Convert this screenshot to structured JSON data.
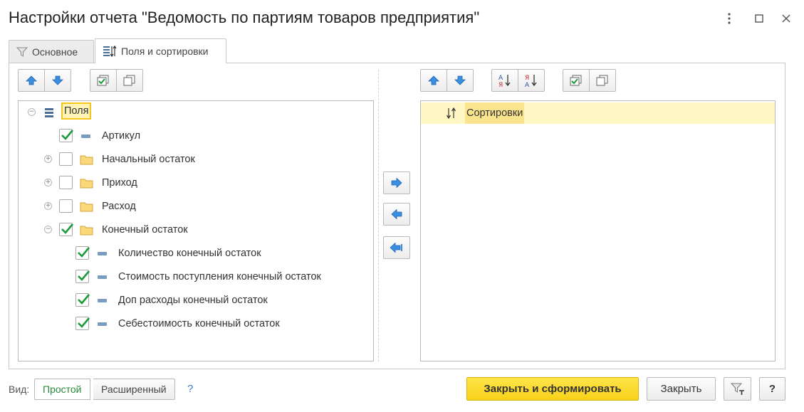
{
  "window": {
    "title": "Настройки отчета \"Ведомость по партиям товаров предприятия\""
  },
  "tabs": [
    {
      "label": "Основное",
      "icon": "filter-icon",
      "active": false
    },
    {
      "label": "Поля и сортировки",
      "icon": "fields-sort-icon",
      "active": true
    }
  ],
  "fields_tree": {
    "root": "Поля",
    "items": [
      {
        "label": "Артикул",
        "checked": true,
        "kind": "field"
      },
      {
        "label": "Начальный остаток",
        "checked": false,
        "kind": "folder",
        "expanded": false
      },
      {
        "label": "Приход",
        "checked": false,
        "kind": "folder",
        "expanded": false
      },
      {
        "label": "Расход",
        "checked": false,
        "kind": "folder",
        "expanded": false
      },
      {
        "label": "Конечный остаток",
        "checked": true,
        "kind": "folder",
        "expanded": true
      },
      {
        "label": "Количество конечный остаток",
        "checked": true,
        "kind": "field"
      },
      {
        "label": "Стоимость поступления конечный остаток",
        "checked": true,
        "kind": "field"
      },
      {
        "label": "Доп расходы конечный остаток",
        "checked": true,
        "kind": "field"
      },
      {
        "label": "Себестоимость конечный остаток",
        "checked": true,
        "kind": "field"
      }
    ]
  },
  "sort_tree": {
    "root": "Сортировки"
  },
  "footer": {
    "view_label": "Вид:",
    "view_simple": "Простой",
    "view_extended": "Расширенный",
    "view_help": "?",
    "generate_button": "Закрыть и сформировать",
    "close_button": "Закрыть",
    "help_button": "?"
  },
  "colors": {
    "accent_green": "#2a8a3a",
    "primary_yellow": "#f8d21a",
    "selection_yellow": "#fff3b8",
    "arrow_blue": "#3a8fe0"
  }
}
